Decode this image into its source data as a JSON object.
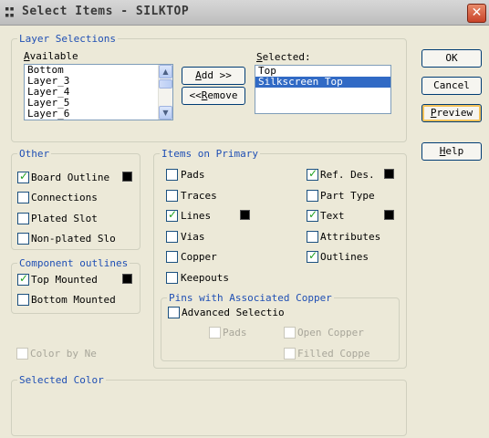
{
  "window": {
    "title": "Select Items - SILKTOP",
    "close_glyph": "✕"
  },
  "layer_selections": {
    "legend": "Layer Selections",
    "available_label": "Available",
    "available_items": [
      "Bottom",
      "Layer_3",
      "Layer_4",
      "Layer_5",
      "Layer_6"
    ],
    "selected_label": "Selected:",
    "selected_items": [
      "Top",
      "Silkscreen Top"
    ],
    "selected_index": 1,
    "add_button": "Add >>",
    "remove_button": "<<Remove"
  },
  "buttons": {
    "ok": "OK",
    "cancel": "Cancel",
    "preview": "Preview",
    "help": "Help"
  },
  "other": {
    "legend": "Other",
    "items": [
      {
        "label": "Board Outline",
        "checked": true,
        "swatch": "#000000"
      },
      {
        "label": "Connections",
        "checked": false
      },
      {
        "label": "Plated Slot",
        "checked": false
      },
      {
        "label": "Non-plated Slo",
        "checked": false
      }
    ]
  },
  "component_outlines": {
    "legend": "Component outlines",
    "items": [
      {
        "label": "Top Mounted",
        "checked": true,
        "swatch": "#000000"
      },
      {
        "label": "Bottom Mounted",
        "checked": false
      }
    ]
  },
  "items_on_primary": {
    "legend": "Items on Primary",
    "left": [
      {
        "label": "Pads",
        "checked": false
      },
      {
        "label": "Traces",
        "checked": false
      },
      {
        "label": "Lines",
        "checked": true,
        "swatch": "#000000"
      },
      {
        "label": "Vias",
        "checked": false
      },
      {
        "label": "Copper",
        "checked": false
      },
      {
        "label": "Keepouts",
        "checked": false
      }
    ],
    "right": [
      {
        "label": "Ref. Des.",
        "checked": true,
        "swatch": "#000000"
      },
      {
        "label": "Part Type",
        "checked": false
      },
      {
        "label": "Text",
        "checked": true,
        "swatch": "#000000"
      },
      {
        "label": "Attributes",
        "checked": false
      },
      {
        "label": "Outlines",
        "checked": true
      }
    ]
  },
  "pins_copper": {
    "legend": "Pins with Associated Copper",
    "advanced": "Advanced Selectio",
    "pads": "Pads",
    "open_copper": "Open Copper",
    "filled_copper": "Filled Coppe"
  },
  "color_by_net": "Color by Ne",
  "selected_color": {
    "legend": "Selected Color"
  },
  "colors": {
    "accent_legend": "#1f4fb4",
    "selection": "#316ac5",
    "check": "#21a121"
  }
}
